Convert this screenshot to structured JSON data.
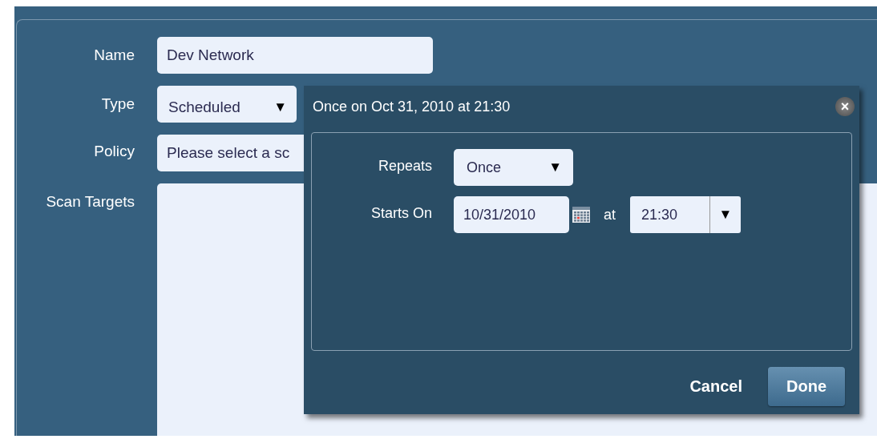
{
  "form": {
    "fields": [
      {
        "label": "Name",
        "kind": "text",
        "value": "Dev Network"
      },
      {
        "label": "Type",
        "kind": "select",
        "value": "Scheduled",
        "arrow": "▼"
      },
      {
        "label": "Policy",
        "kind": "text",
        "value": "Please select a sc"
      },
      {
        "label": "Scan Targets",
        "kind": "textarea"
      }
    ]
  },
  "dialog": {
    "title": "Once on Oct 31, 2010 at 21:30",
    "close": "×",
    "repeats": {
      "label": "Repeats",
      "value": "Once",
      "arrow": "▼"
    },
    "starts_on": {
      "label": "Starts On",
      "date": "10/31/2010",
      "at": "at",
      "time": "21:30",
      "arrow": "▼"
    },
    "buttons": [
      {
        "label": "Cancel",
        "kind": "link"
      },
      {
        "label": "Done",
        "kind": "primary"
      }
    ]
  }
}
